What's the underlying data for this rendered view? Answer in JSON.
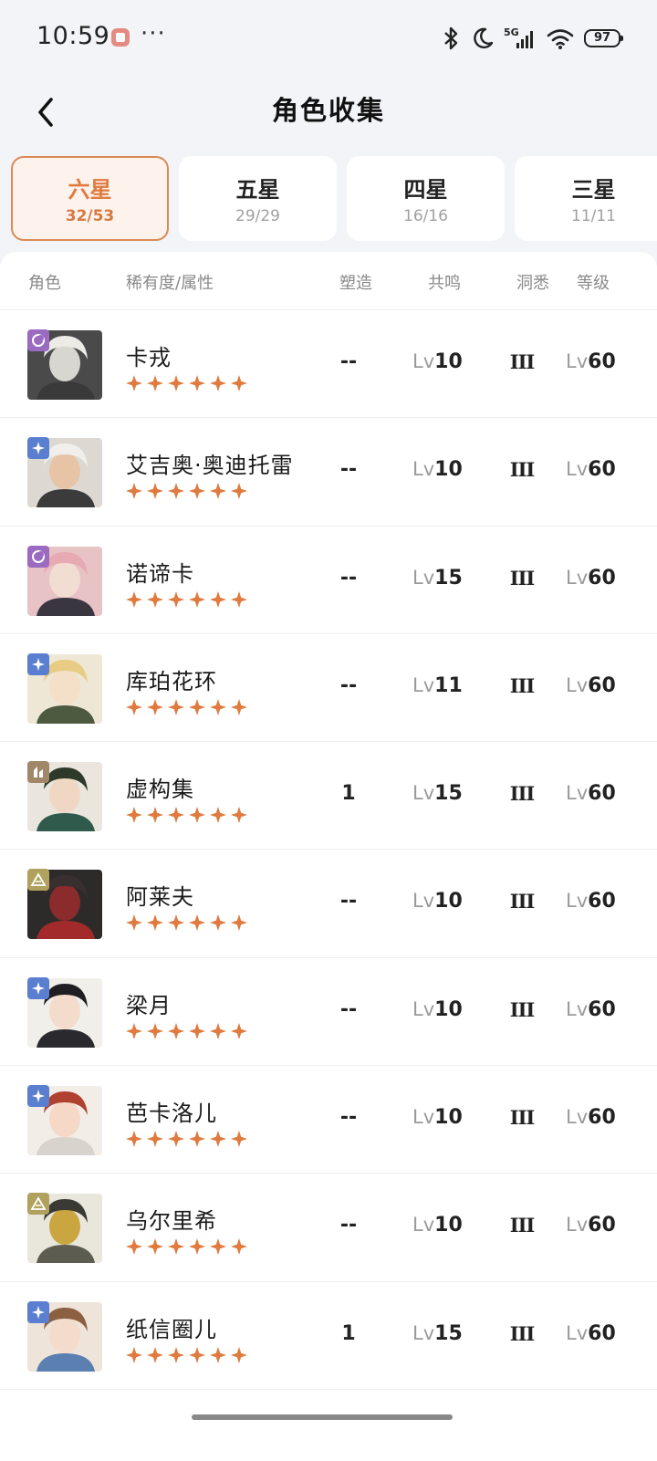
{
  "status_bar": {
    "time": "10:59",
    "dots": "···",
    "network": "5G",
    "battery": "97"
  },
  "header": {
    "title": "角色收集"
  },
  "tabs": [
    {
      "label": "六星",
      "count": "32/53",
      "active": true
    },
    {
      "label": "五星",
      "count": "29/29",
      "active": false
    },
    {
      "label": "四星",
      "count": "16/16",
      "active": false
    },
    {
      "label": "三星",
      "count": "11/11",
      "active": false
    }
  ],
  "table": {
    "columns": {
      "role": "角色",
      "rarity": "稀有度/属性",
      "mold": "塑造",
      "resonance": "共鸣",
      "insight": "洞悉",
      "level": "等级"
    },
    "lv_prefix": "Lv",
    "star_color": "#e07a3f",
    "rows": [
      {
        "name": "卡戎",
        "attribute": "moon-icon",
        "attr_color": "#9a6bc0",
        "mold": "--",
        "resonance": "10",
        "insight": "III",
        "level": "60"
      },
      {
        "name": "艾吉奥·奥迪托雷",
        "attribute": "star-icon",
        "attr_color": "#5a7fd0",
        "mold": "--",
        "resonance": "10",
        "insight": "III",
        "level": "60"
      },
      {
        "name": "诺谛卡",
        "attribute": "moon-icon",
        "attr_color": "#9a6bc0",
        "mold": "--",
        "resonance": "15",
        "insight": "III",
        "level": "60"
      },
      {
        "name": "库珀花环",
        "attribute": "star-icon",
        "attr_color": "#5a7fd0",
        "mold": "--",
        "resonance": "11",
        "insight": "III",
        "level": "60"
      },
      {
        "name": "虚构集",
        "attribute": "mineral-icon",
        "attr_color": "#a0876a",
        "mold": "1",
        "resonance": "15",
        "insight": "III",
        "level": "60"
      },
      {
        "name": "阿莱夫",
        "attribute": "pyramid-icon",
        "attr_color": "#b0a15e",
        "mold": "--",
        "resonance": "10",
        "insight": "III",
        "level": "60"
      },
      {
        "name": "梁月",
        "attribute": "star-icon",
        "attr_color": "#5a7fd0",
        "mold": "--",
        "resonance": "10",
        "insight": "III",
        "level": "60"
      },
      {
        "name": "芭卡洛儿",
        "attribute": "star-icon",
        "attr_color": "#5a7fd0",
        "mold": "--",
        "resonance": "10",
        "insight": "III",
        "level": "60"
      },
      {
        "name": "乌尔里希",
        "attribute": "pyramid-icon",
        "attr_color": "#b0a15e",
        "mold": "--",
        "resonance": "10",
        "insight": "III",
        "level": "60"
      },
      {
        "name": "纸信圈儿",
        "attribute": "star-icon",
        "attr_color": "#5a7fd0",
        "mold": "1",
        "resonance": "15",
        "insight": "III",
        "level": "60"
      }
    ]
  }
}
